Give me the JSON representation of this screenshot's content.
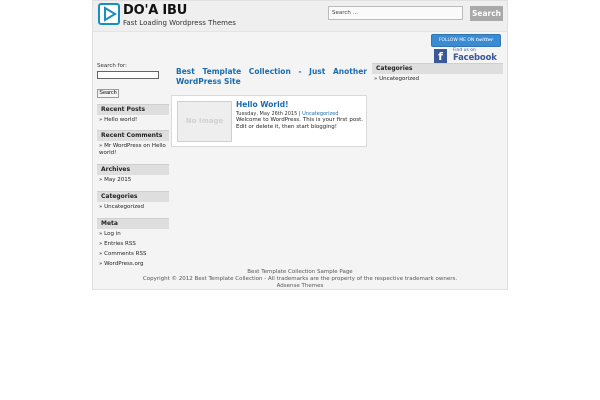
{
  "header": {
    "title": "DO'A IBU",
    "tagline": "Fast Loading Wordpress Themes",
    "search_placeholder": "Search ...",
    "search_button": "Search"
  },
  "social": {
    "twitter_prefix": "FOLLOW ME ON",
    "twitter_brand": "twitter",
    "facebook_line1": "Find us on",
    "facebook_line2": "Facebook"
  },
  "left_sidebar": {
    "search_label": "Search for:",
    "search_button": "Search",
    "widgets": [
      {
        "title": "Recent Posts",
        "items": [
          "» Hello world!"
        ]
      },
      {
        "title": "Recent Comments",
        "items": [
          "» Mr WordPress on Hello world!"
        ]
      },
      {
        "title": "Archives",
        "items": [
          "» May 2015"
        ]
      },
      {
        "title": "Categories",
        "items": [
          "» Uncategorized"
        ]
      },
      {
        "title": "Meta",
        "items": [
          "» Log in",
          "» Entries RSS",
          "» Comments RSS",
          "» WordPress.org"
        ]
      }
    ]
  },
  "content": {
    "page_heading": "Best Template Collection - Just Another WordPress Site",
    "post": {
      "title": "Hello World!",
      "date": "Tuesday, May 26th 2015",
      "separator": "|",
      "category": "Uncategorized",
      "excerpt": "Welcome to WordPress. This is your first post. Edit or delete it, then start blogging!",
      "thumbnail_text": "No Image"
    }
  },
  "right_sidebar": {
    "widgets": [
      {
        "title": "Categories",
        "items": [
          "» Uncategorized"
        ]
      }
    ]
  },
  "footer": {
    "line1": "Best Template Collection Sample Page",
    "line2": "Copyright © 2012 Best Template Collection - All trademarks are the property of the respective trademark owners.",
    "line3": "Adsense Themes"
  },
  "colors": {
    "link": "#1a6cb0",
    "logo": "#1a8fbf",
    "twitter": "#3a8bd1",
    "facebook": "#3b5998"
  }
}
